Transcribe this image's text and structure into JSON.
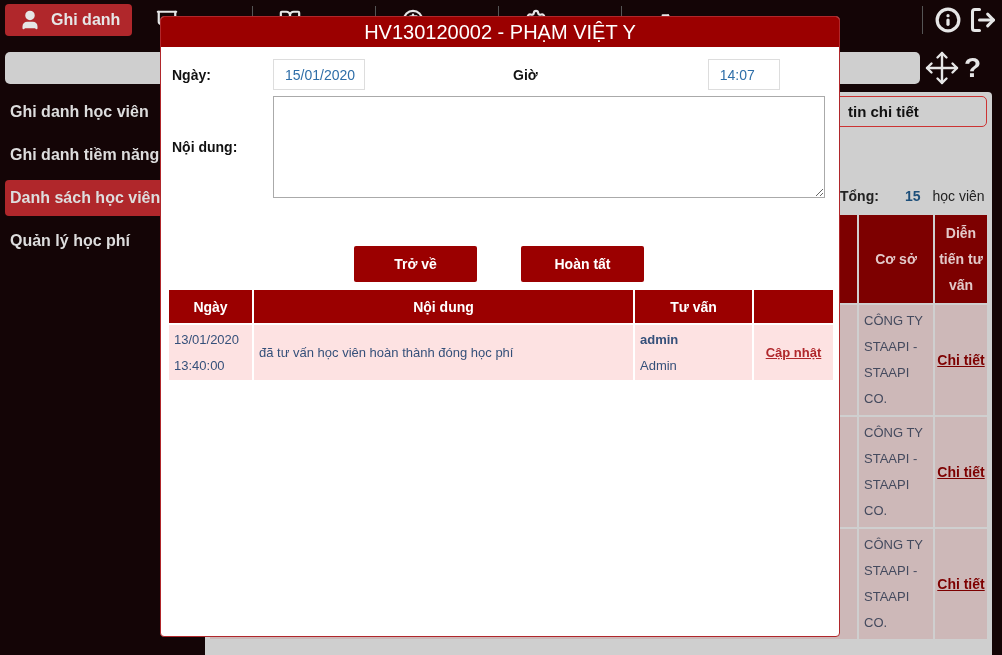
{
  "nav": {
    "items": [
      {
        "label": "Ghi danh",
        "selected": true
      },
      {
        "selected": false
      },
      {
        "selected": false
      },
      {
        "selected": false
      },
      {
        "selected": false
      },
      {
        "selected": false
      }
    ],
    "help": "?"
  },
  "sidebar": {
    "items": [
      {
        "label": "Ghi danh học viên",
        "selected": false
      },
      {
        "label": "Ghi danh tiềm năng",
        "selected": false
      },
      {
        "label": "Danh sách học viên",
        "selected": true
      },
      {
        "label": "Quản lý học phí",
        "selected": false
      }
    ]
  },
  "content": {
    "detail_tab": "tin chi tiết",
    "total_label": "Tổng:",
    "total_value": "15",
    "total_unit": "học viên",
    "table": {
      "columns": [
        "Cơ sở",
        "Diễn tiến tư vấn"
      ],
      "rows": [
        {
          "branch": "CÔNG TY STAAPI - STAAPI CO.",
          "action": "Chi tiết"
        },
        {
          "branch": "CÔNG TY STAAPI - STAAPI CO.",
          "action": "Chi tiết"
        },
        {
          "branch": "CÔNG TY STAAPI - STAAPI CO.",
          "action": "Chi tiết"
        }
      ]
    }
  },
  "dialog": {
    "title": "HV130120002 - PHẠM VIỆT Y",
    "date_label": "Ngày:",
    "date_value": "15/01/2020",
    "time_label": "Giờ",
    "time_value": "14:07",
    "content_label": "Nội dung:",
    "buttons": [
      "Trở về",
      "Hoàn tất"
    ],
    "history": {
      "columns": [
        "Ngày",
        "Nội dung",
        "Tư vấn",
        ""
      ],
      "rows": [
        {
          "date": "13/01/2020",
          "time": "13:40:00",
          "content": "đã tư vấn học viên hoàn thành đóng học phí",
          "user": "admin",
          "user_name": "Admin",
          "action": "Cập nhật"
        }
      ]
    }
  }
}
